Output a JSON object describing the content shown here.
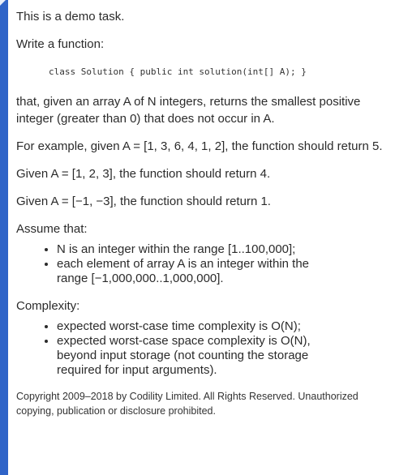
{
  "task": {
    "intro": "This is a demo task.",
    "write_function": "Write a function:",
    "signature": "class Solution { public int solution(int[] A); }",
    "description": "that, given an array A of N integers, returns the smallest positive integer (greater than 0) that does not occur in A.",
    "example1": "For example, given A = [1, 3, 6, 4, 1, 2], the function should return 5.",
    "example2": "Given A = [1, 2, 3], the function should return 4.",
    "example3": "Given A = [−1, −3], the function should return 1.",
    "assume_heading": "Assume that:",
    "assumptions": [
      "N is an integer within the range [1..100,000];",
      "each element of array A is an integer within the range [−1,000,000..1,000,000]."
    ],
    "complexity_heading": "Complexity:",
    "complexity": [
      "expected worst-case time complexity is O(N);",
      "expected worst-case space complexity is O(N), beyond input storage (not counting the storage required for input arguments)."
    ],
    "copyright": "Copyright 2009–2018 by Codility Limited. All Rights Reserved. Unauthorized copying, publication or disclosure prohibited."
  },
  "colors": {
    "left_bar": "#2f64c8",
    "text": "#2b2b2b",
    "background": "#ffffff"
  }
}
